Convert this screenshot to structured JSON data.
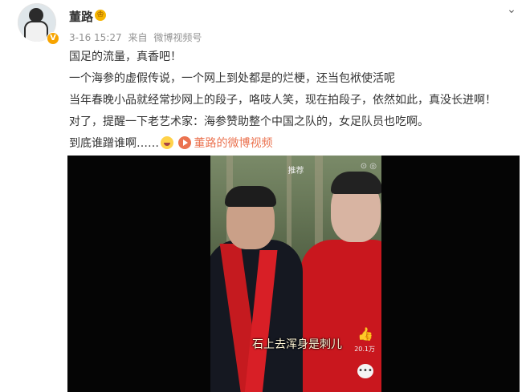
{
  "post": {
    "username": "董路",
    "timestamp": "3-16 15:27",
    "source_prefix": "来自",
    "source": "微博视频号",
    "lines": [
      "国足的流量，真香吧！",
      "一个海参的虚假传说，一个网上到处都是的烂梗，还当包袱使活呢",
      "当年春晚小品就经常抄网上的段子，咯吱人笑，现在拍段子，依然如此，真没长进啊！",
      "对了，提醒一下老艺术家：海参赞助整个中国之队的，女足队员也吃啊。"
    ],
    "last_line_text": "到底谁蹭谁啊……",
    "video_link_label": "董路的微博视频"
  },
  "video": {
    "top_label": "推荐",
    "subtitle": "石上去浑身是刺儿",
    "like_count": "20.1万"
  },
  "icons": {
    "more": "chevron-down-icon",
    "verified": "verified-badge-icon",
    "emoji": "laugh-emoji-icon",
    "play": "play-icon",
    "like": "thumbs-up-icon",
    "comment": "comment-icon"
  },
  "colors": {
    "link": "#eb7350",
    "meta": "#939393",
    "verified": "#f7a400"
  }
}
